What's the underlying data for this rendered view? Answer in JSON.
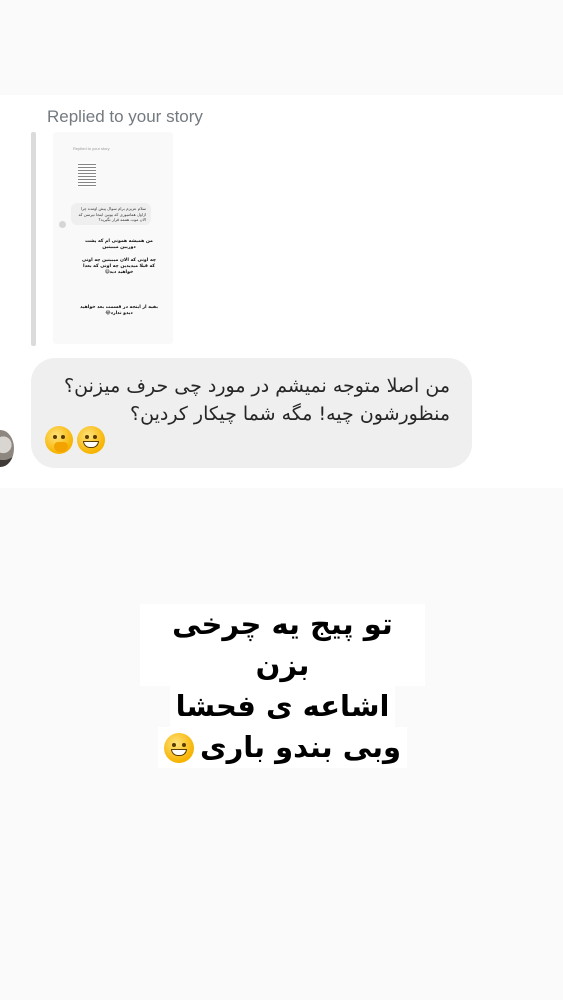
{
  "dm": {
    "replied_label": "Replied to your story",
    "thumbnail": {
      "replied_label": "Replied to your story",
      "bubble_text": "سلام عزیزم برام سوال پیش اومده چرا اژاول همامیوری که یوبین اینجا نپرسن که الان موت هممه قرار نگیرید؟",
      "text_1": "من همیشه همونی ام که پشت دوربین میبینین",
      "text_2": "چه اونی که الان میبینین چه اونی که قبلا میدیدین چه اونی که بعدا خواهید دید😄",
      "text_3": "بقیه از اینجه در قسمت بعد خواهید دیدو ندارد😂"
    },
    "message": {
      "text": "من اصلا متوجه نمیشم در مورد چی حرف میزنن؟ منظورشون چیه! مگه شما چیکار کردین؟",
      "emojis": [
        "face-with-hand-over-mouth-emoji",
        "grinning-face-emoji"
      ]
    }
  },
  "caption": {
    "line_1": "تو پیج یه چرخی بزن",
    "line_2": "اشاعه ی فحشا",
    "line_3": "وبی بندو باری",
    "emoji": "grinning-face-emoji"
  },
  "colors": {
    "background": "#fafafa",
    "bubble": "#efefef",
    "label": "#737a80"
  }
}
